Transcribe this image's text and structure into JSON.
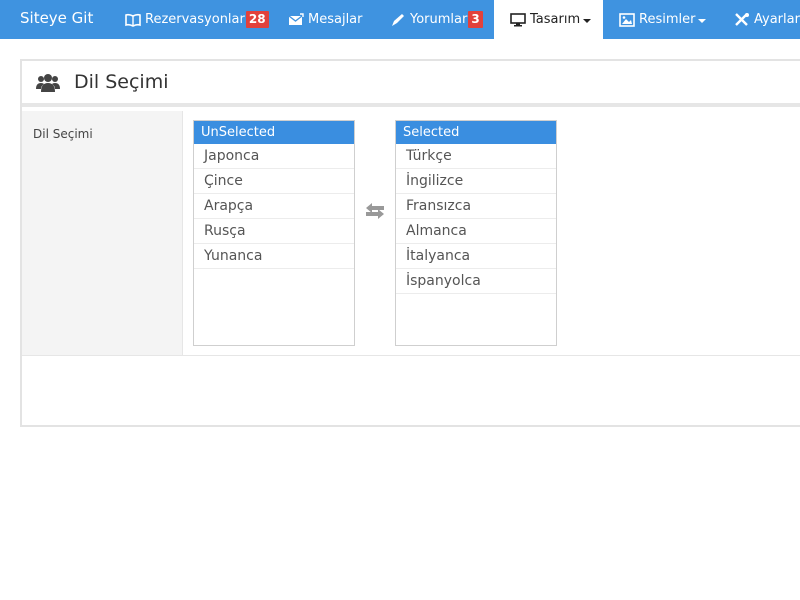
{
  "navbar": {
    "brand": "Siteye Git",
    "items": [
      {
        "label": "Rezervasyonlar",
        "badge": "28",
        "icon": "book-icon"
      },
      {
        "label": "Mesajlar",
        "icon": "envelope-icon"
      },
      {
        "label": "Yorumlar",
        "badge": "3",
        "icon": "pencil-icon"
      },
      {
        "label": "Tasarım",
        "icon": "desktop-icon",
        "active": true
      },
      {
        "label": "Resimler",
        "icon": "picture-icon"
      },
      {
        "label": "Ayarlar",
        "icon": "tools-icon"
      }
    ]
  },
  "panel": {
    "title": "Dil Seçimi",
    "icon": "users-icon"
  },
  "form": {
    "label": "Dil Seçimi",
    "unselected": {
      "header": "UnSelected",
      "items": [
        "Japonca",
        "Çince",
        "Arapça",
        "Rusça",
        "Yunanca"
      ]
    },
    "selected": {
      "header": "Selected",
      "items": [
        "Türkçe",
        "İngilizce",
        "Fransızca",
        "Almanca",
        "İtalyanca",
        "İspanyolca"
      ]
    }
  },
  "colors": {
    "navbar": "#3f93e0",
    "list_header": "#3a8ee0",
    "badge": "#e2413c"
  }
}
